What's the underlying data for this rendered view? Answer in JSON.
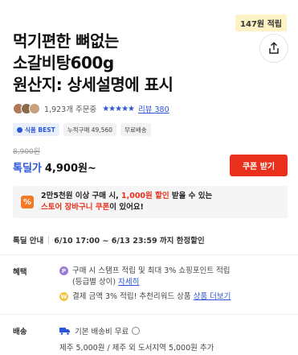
{
  "points_badge": "147원 적립",
  "title": {
    "line1": "먹기편한 뼈없는",
    "line2": "소갈비탕600g",
    "line3": "원산지: 상세설명에 표시"
  },
  "rating": {
    "orders": "1,923개 주문중",
    "stars": "★★★★★",
    "review_link": "리뷰 380"
  },
  "tags": {
    "best": "식품 BEST",
    "cumulative": "누적구매 49,560",
    "shipping": "무료배송"
  },
  "price": {
    "original": "8,900원",
    "deal_label": "톡딜가",
    "current": "4,900원~",
    "coupon_button": "쿠폰 받기"
  },
  "promo": {
    "icon": "%",
    "line1_pre": "2만5천원 이상 구매 시, ",
    "line1_highlight": "1,000원 할인",
    "line1_post": " 받을 수 있는",
    "line2_highlight": "스토어 장바구니 쿠폰",
    "line2_post": "이 있어요!"
  },
  "deal_info": {
    "label": "톡딜 안내",
    "value": "6/10 17:00 ~ 6/13 23:59 까지 한정할인"
  },
  "benefits": {
    "label": "혜택",
    "line1": "구매 시 스탬프 적립 및 최대 3% 쇼핑포인트 적립",
    "line2_pre": "(등급별 상이) ",
    "line2_link": "자세히",
    "line3_pre": "결제 금액 3% 적립! 추천리워드 상품 ",
    "line3_link": "상품 더보기"
  },
  "shipping": {
    "label": "배송",
    "line1": "기본 배송비 무료",
    "line2": "제주 5,000원 / 제주 외 도서지역 5,000원 추가"
  },
  "colors": {
    "accent_blue": "#2a56d8",
    "coupon_red": "#e8301c",
    "promo_orange": "#f47a2a"
  }
}
